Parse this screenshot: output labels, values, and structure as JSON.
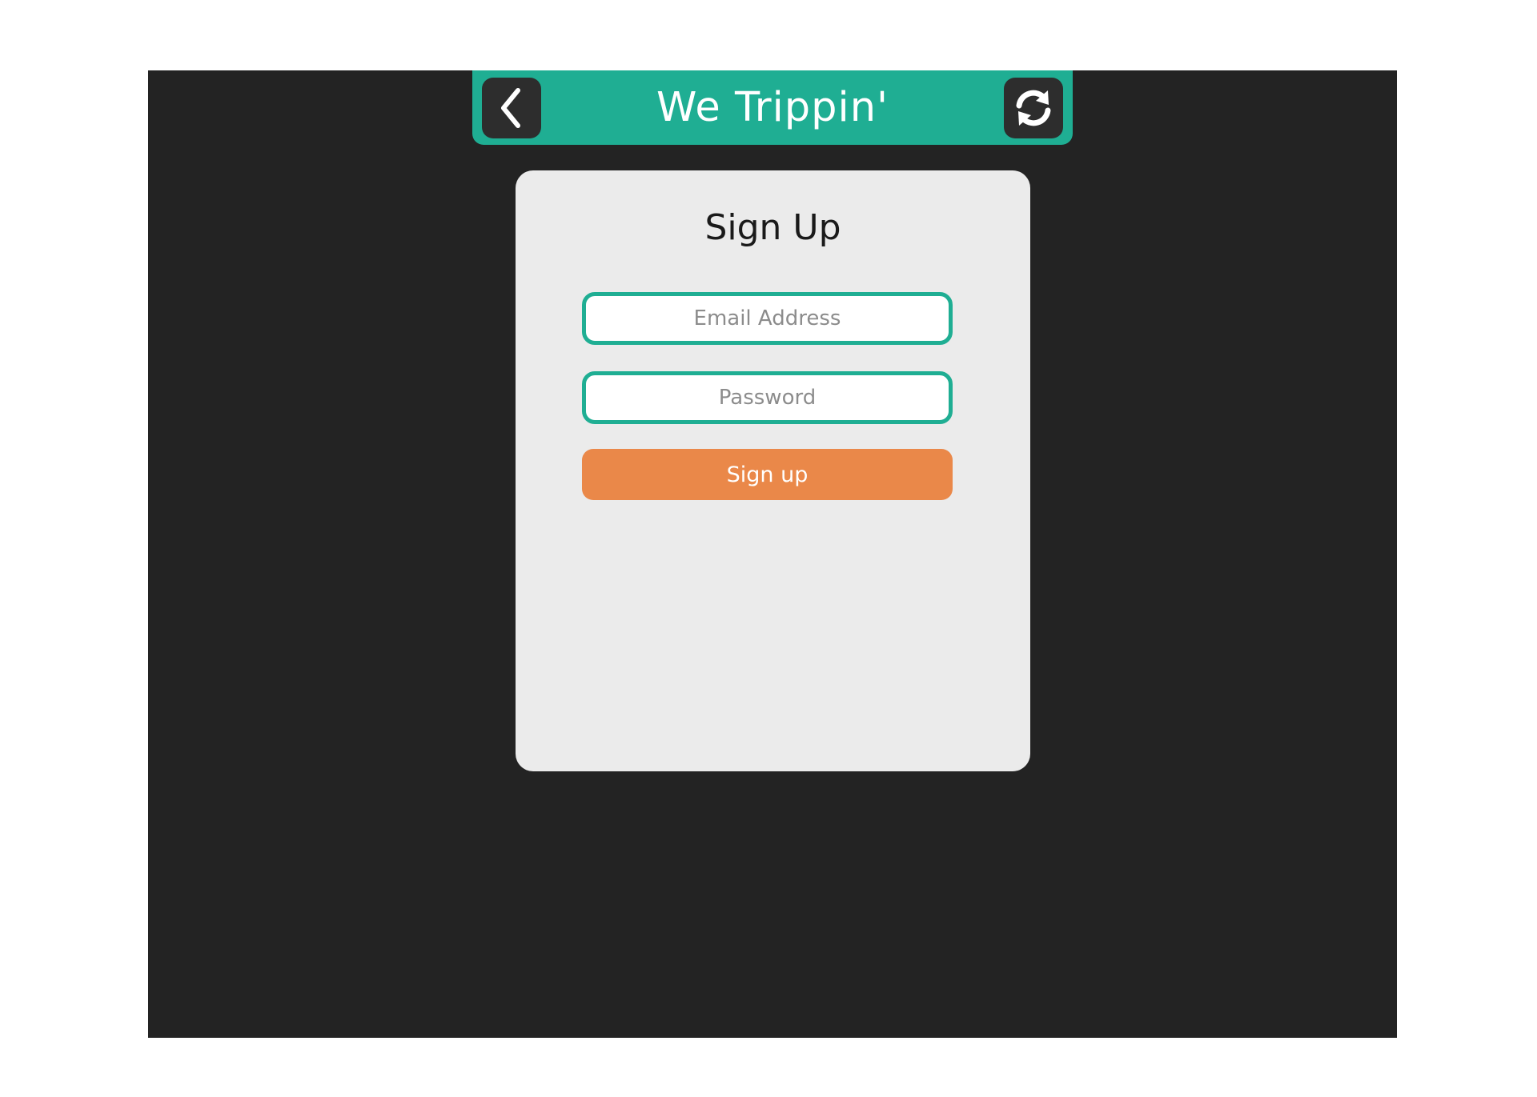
{
  "app": {
    "title": "We Trippin'"
  },
  "header": {
    "back_icon": "chevron-left-icon",
    "refresh_icon": "refresh-icon"
  },
  "signup": {
    "heading": "Sign Up",
    "email_placeholder": "Email Address",
    "email_value": "",
    "password_placeholder": "Password",
    "password_value": "",
    "button_label": "Sign up"
  },
  "colors": {
    "page_background": "#232323",
    "header_teal": "#1fae93",
    "card_background": "#ebebeb",
    "button_orange": "#ea8849",
    "icon_button_background": "#2d2d2d"
  }
}
